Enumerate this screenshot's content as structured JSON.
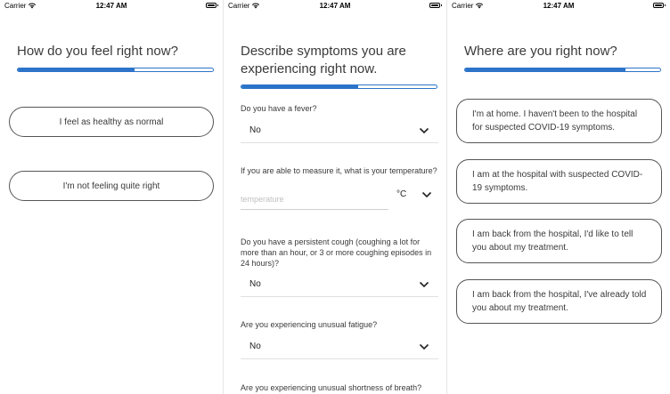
{
  "status": {
    "carrier": "Carrier",
    "time": "12:47 AM"
  },
  "screen1": {
    "title": "How do you feel right now?",
    "progress": 0.6,
    "options": [
      "I feel as healthy as normal",
      "I'm not feeling quite right"
    ]
  },
  "screen2": {
    "title": "Describe symptoms you are experiencing right now.",
    "progress": 0.6,
    "fever": {
      "question": "Do you have a fever?",
      "value": "No"
    },
    "temperature": {
      "question": "If you are able to measure it, what is your temperature?",
      "placeholder": "temperature",
      "unit": "°C"
    },
    "cough": {
      "question": "Do you have a persistent cough (coughing a lot for more than an hour, or 3 or more coughing episodes in 24 hours)?",
      "value": "No"
    },
    "fatigue": {
      "question": "Are you experiencing unusual fatigue?",
      "value": "No"
    },
    "breath": {
      "question": "Are you experiencing unusual shortness of breath?"
    }
  },
  "screen3": {
    "title": "Where are you right now?",
    "progress": 0.82,
    "options": [
      "I'm at home. I haven't been to the hospital for suspected COVID-19 symptoms.",
      "I am at the hospital with suspected COVID-19 symptoms.",
      "I am back from the hospital, I'd like to tell you about my treatment.",
      "I am back from the hospital, I've already told you about my treatment."
    ]
  },
  "colors": {
    "accent": "#2c74c9",
    "text": "#3a3a3a",
    "border": "#555555"
  },
  "icons": {
    "wifi": "wifi-icon",
    "battery": "battery-icon",
    "chevron": "chevron-down-icon"
  }
}
